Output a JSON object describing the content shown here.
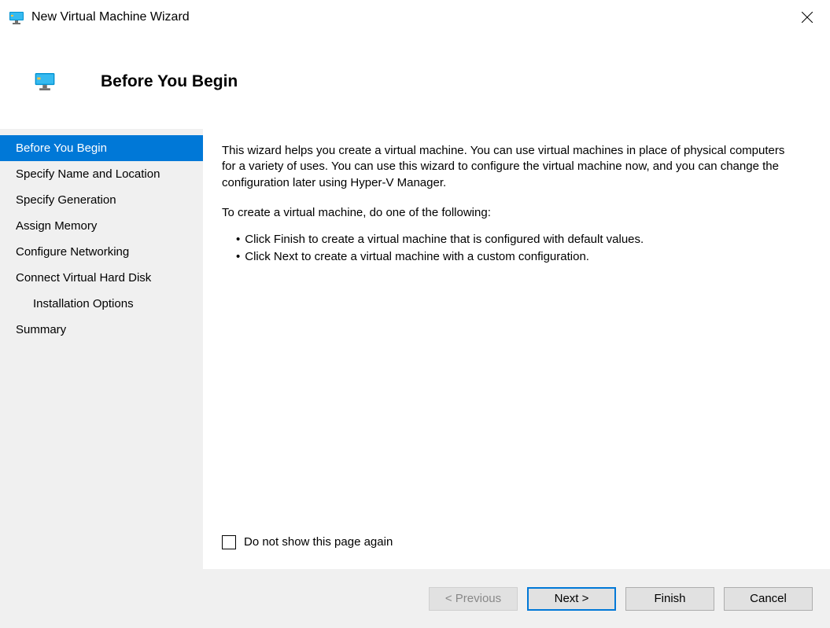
{
  "window": {
    "title": "New Virtual Machine Wizard"
  },
  "header": {
    "title": "Before You Begin"
  },
  "sidebar": {
    "items": [
      {
        "label": "Before You Begin",
        "active": true,
        "indent": false
      },
      {
        "label": "Specify Name and Location",
        "active": false,
        "indent": false
      },
      {
        "label": "Specify Generation",
        "active": false,
        "indent": false
      },
      {
        "label": "Assign Memory",
        "active": false,
        "indent": false
      },
      {
        "label": "Configure Networking",
        "active": false,
        "indent": false
      },
      {
        "label": "Connect Virtual Hard Disk",
        "active": false,
        "indent": false
      },
      {
        "label": "Installation Options",
        "active": false,
        "indent": true
      },
      {
        "label": "Summary",
        "active": false,
        "indent": false
      }
    ]
  },
  "content": {
    "paragraph1": "This wizard helps you create a virtual machine. You can use virtual machines in place of physical computers for a variety of uses. You can use this wizard to configure the virtual machine now, and you can change the configuration later using Hyper-V Manager.",
    "paragraph2": "To create a virtual machine, do one of the following:",
    "bullets": [
      "Click Finish to create a virtual machine that is configured with default values.",
      "Click Next to create a virtual machine with a custom configuration."
    ],
    "checkbox_label": "Do not show this page again"
  },
  "footer": {
    "previous": "< Previous",
    "next": "Next >",
    "finish": "Finish",
    "cancel": "Cancel"
  }
}
